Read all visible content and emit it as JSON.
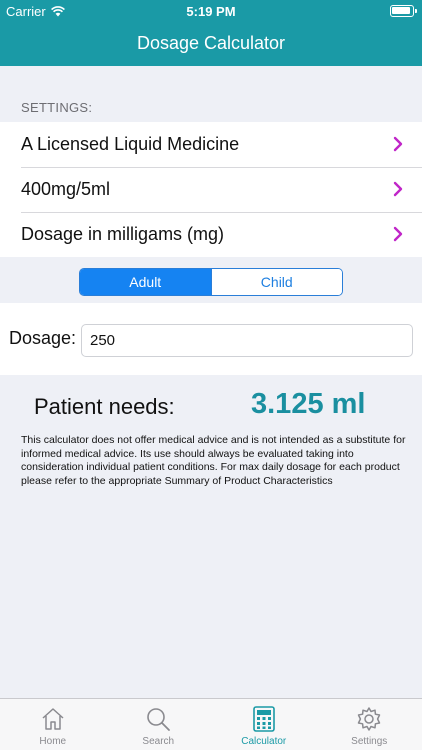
{
  "status_bar": {
    "carrier": "Carrier",
    "time": "5:19 PM"
  },
  "nav": {
    "title": "Dosage Calculator"
  },
  "settings": {
    "header": "SETTINGS:",
    "items": [
      {
        "label": "A Licensed Liquid Medicine"
      },
      {
        "label": "400mg/5ml"
      },
      {
        "label": "Dosage in milligams (mg)"
      }
    ]
  },
  "segment": {
    "options": [
      "Adult",
      "Child"
    ],
    "selected": "Adult"
  },
  "dosage": {
    "label": "Dosage:",
    "value": "250"
  },
  "result": {
    "label": "Patient needs:",
    "value": "3.125 ml",
    "disclaimer": "This calculator does not offer medical advice and  is not intended as a substitute for informed medical advice. Its use should always be evaluated taking into consideration individual patient conditions. For max daily dosage for each product please refer to the appropriate Summary of Product Characteristics"
  },
  "tabs": [
    {
      "label": "Home",
      "icon": "home-icon"
    },
    {
      "label": "Search",
      "icon": "search-icon"
    },
    {
      "label": "Calculator",
      "icon": "calculator-icon"
    },
    {
      "label": "Settings",
      "icon": "gear-icon"
    }
  ],
  "colors": {
    "teal": "#1a9aa6",
    "accent_blue": "#1583f2",
    "chevron": "#c026c8",
    "background": "#eef0f6"
  }
}
